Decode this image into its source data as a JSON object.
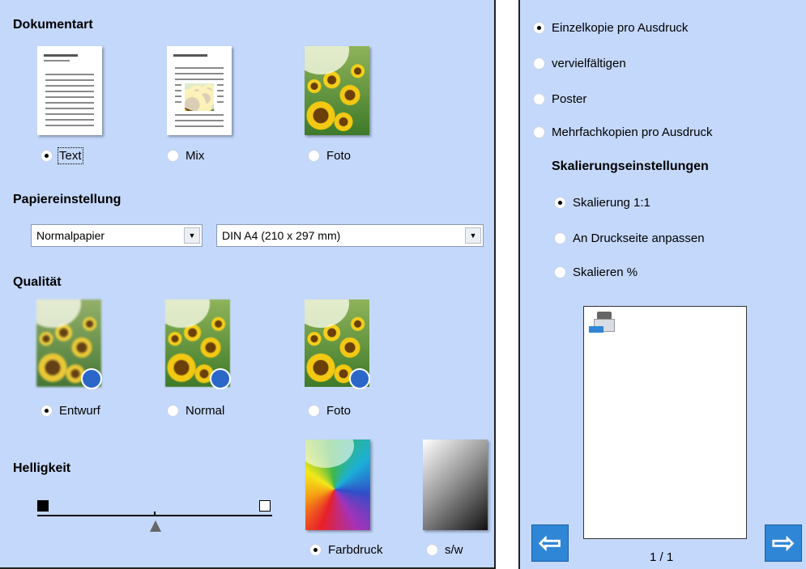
{
  "left": {
    "dokumentart": {
      "heading": "Dokumentart",
      "options": [
        {
          "label": "Text",
          "selected": true,
          "icon": "text-document-icon"
        },
        {
          "label": "Mix",
          "selected": false,
          "icon": "mixed-document-icon"
        },
        {
          "label": "Foto",
          "selected": false,
          "icon": "photo-document-icon"
        }
      ]
    },
    "papier": {
      "heading": "Papiereinstellung",
      "paper_type": "Normalpapier",
      "paper_size": "DIN A4 (210 x 297 mm)"
    },
    "qualitaet": {
      "heading": "Qualität",
      "options": [
        {
          "label": "Entwurf",
          "selected": true,
          "icon": "draft-quality-icon"
        },
        {
          "label": "Normal",
          "selected": false,
          "icon": "normal-quality-icon"
        },
        {
          "label": "Foto",
          "selected": false,
          "icon": "photo-quality-icon"
        }
      ]
    },
    "helligkeit": {
      "heading": "Helligkeit",
      "slider_level": 0.5,
      "min_icon": "dark-square-icon",
      "max_icon": "light-square-icon"
    },
    "farbe": {
      "options": [
        {
          "label": "Farbdruck",
          "selected": true,
          "icon": "color-gradient-icon"
        },
        {
          "label": "s/w",
          "selected": false,
          "icon": "grayscale-gradient-icon"
        }
      ]
    }
  },
  "right": {
    "layout_options": [
      {
        "label": "Einzelkopie pro Ausdruck",
        "selected": true
      },
      {
        "label": "vervielfältigen",
        "selected": false
      },
      {
        "label": "Poster",
        "selected": false
      },
      {
        "label": "Mehrfachkopien pro Ausdruck",
        "selected": false
      }
    ],
    "scaling": {
      "heading": "Skalierungseinstellungen",
      "options": [
        {
          "label": "Skalierung 1:1",
          "selected": true
        },
        {
          "label": "An Druckseite anpassen",
          "selected": false
        },
        {
          "label": "Skalieren %",
          "selected": false
        }
      ]
    },
    "preview": {
      "page_indicator": "1 / 1",
      "prev_icon": "arrow-left-icon",
      "next_icon": "arrow-right-icon",
      "thumbnail_icon": "scanner-icon"
    }
  },
  "colors": {
    "panel_bg": "#c4d8fb",
    "accent_blue": "#2f86d6"
  }
}
